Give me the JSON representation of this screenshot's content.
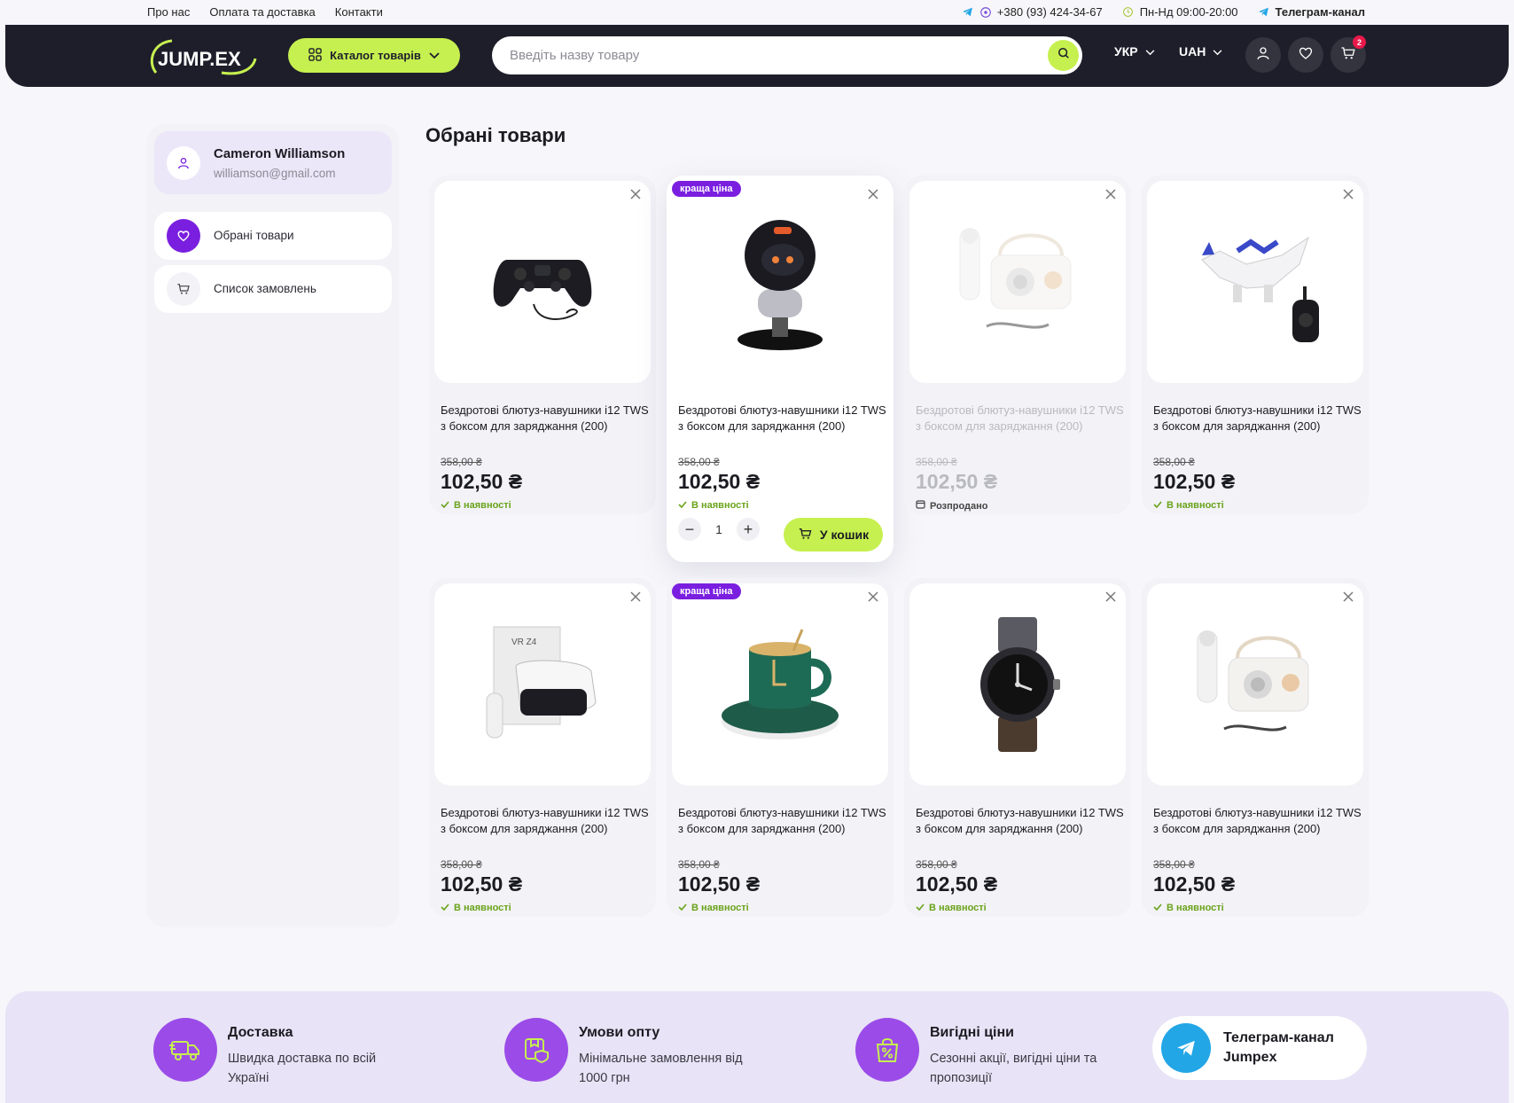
{
  "topbar": {
    "links": [
      "Про нас",
      "Оплата та доставка",
      "Контакти"
    ],
    "phone": "+380 (93) 424-34-67",
    "hours": "Пн-Нд 09:00-20:00",
    "telegram": "Телеграм-канал"
  },
  "header": {
    "logo_text": "JUMP.EX",
    "catalog_label": "Каталог товарів",
    "search_placeholder": "Введіть назву товару",
    "language": "УКР",
    "currency": "UAH",
    "cart_count": "2"
  },
  "sidebar": {
    "user_name": "Cameron Williamson",
    "user_email": "williamson@gmail.com",
    "items": [
      {
        "label": "Обрані товари",
        "icon": "heart-icon",
        "active": true
      },
      {
        "label": "Список замовлень",
        "icon": "cart-icon",
        "active": false
      }
    ]
  },
  "page_title": "Обрані товари",
  "products": [
    {
      "title": "Бездротові блютуз-навушники i12 TWS з боксом для заряджання (200)",
      "old_price": "358,00 ₴",
      "price": "102,50 ₴",
      "stock": "В наявності",
      "in_stock": true,
      "promo": "",
      "image": "gamepad"
    },
    {
      "title": "Бездротові блютуз-навушники i12 TWS з боксом для заряджання (200)",
      "old_price": "358,00 ₴",
      "price": "102,50 ₴",
      "stock": "В наявності",
      "in_stock": true,
      "promo": "краща ціна",
      "image": "robot",
      "active": true,
      "qty": "1",
      "cart_label": "У кошик"
    },
    {
      "title": "Бездротові блютуз-навушники i12 TWS з боксом для заряджання (200)",
      "old_price": "358,00 ₴",
      "price": "102,50 ₴",
      "stock": "Розпродано",
      "in_stock": false,
      "promo": "",
      "image": "speaker"
    },
    {
      "title": "Бездротові блютуз-навушники i12 TWS з боксом для заряджання (200)",
      "old_price": "358,00 ₴",
      "price": "102,50 ₴",
      "stock": "В наявності",
      "in_stock": true,
      "promo": "",
      "image": "dino"
    },
    {
      "title": "Бездротові блютуз-навушники i12 TWS з боксом для заряджання (200)",
      "old_price": "358,00 ₴",
      "price": "102,50 ₴",
      "stock": "В наявності",
      "in_stock": true,
      "promo": "",
      "image": "vr"
    },
    {
      "title": "Бездротові блютуз-навушники i12 TWS з боксом для заряджання (200)",
      "old_price": "358,00 ₴",
      "price": "102,50 ₴",
      "stock": "В наявності",
      "in_stock": true,
      "promo": "краща ціна",
      "image": "mug"
    },
    {
      "title": "Бездротові блютуз-навушники i12 TWS з боксом для заряджання (200)",
      "old_price": "358,00 ₴",
      "price": "102,50 ₴",
      "stock": "В наявності",
      "in_stock": true,
      "promo": "",
      "image": "watch"
    },
    {
      "title": "Бездротові блютуз-навушники i12 TWS з боксом для заряджання (200)",
      "old_price": "358,00 ₴",
      "price": "102,50 ₴",
      "stock": "В наявності",
      "in_stock": true,
      "promo": "",
      "image": "speaker"
    }
  ],
  "features": [
    {
      "title": "Доставка",
      "text": "Швидка доставка по всій Україні",
      "icon": "truck-icon"
    },
    {
      "title": "Умови опту",
      "text": "Мінімальне замовлення від 1000 грн",
      "icon": "box-shield-icon"
    },
    {
      "title": "Вигідні ціни",
      "text": "Сезонні акції, вигідні ціни та пропозиції",
      "icon": "discount-bag-icon"
    }
  ],
  "telegram_card": "Телеграм-канал Jumpex",
  "colors": {
    "accent": "#c6f04f",
    "header_bg": "#1e1e2b",
    "purple": "#7a1fe0",
    "feature_icon": "#9a4be8",
    "telegram": "#23a6e6",
    "in_stock": "#6aa31a"
  }
}
